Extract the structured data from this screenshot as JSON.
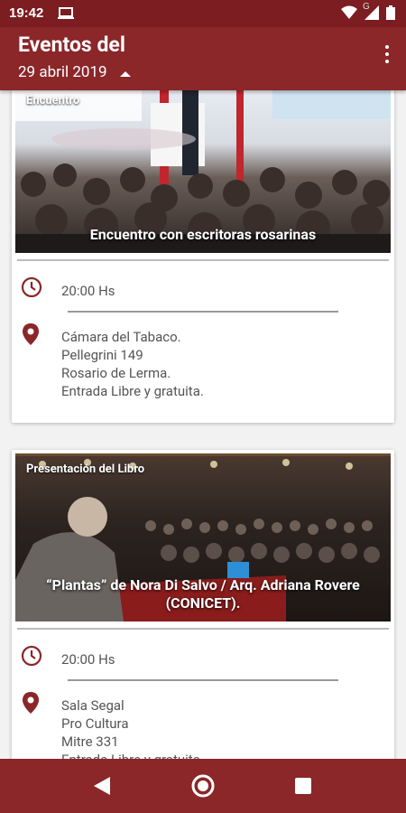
{
  "status": {
    "time": "19:42",
    "signal_label": "G"
  },
  "appbar": {
    "title_line1": "Eventos del",
    "title_line2": "29 abril 2019"
  },
  "events": [
    {
      "category": "Encuentro",
      "caption": "Encuentro con escritoras rosarinas",
      "time": "20:00 Hs",
      "location": [
        "Cámara del Tabaco.",
        "Pellegrini 149",
        "Rosario de Lerma.",
        "Entrada Libre y gratuita."
      ]
    },
    {
      "category": "Presentación del Libro",
      "caption": "“Plantas” de Nora Di Salvo / Arq. Adriana Rovere (CONICET).",
      "time": "20:00 Hs",
      "location": [
        "Sala Segal",
        "Pro Cultura",
        "Mitre 331",
        "Entrada Libre y gratuita."
      ]
    }
  ],
  "colors": {
    "primary": "#8b2629",
    "status_bar": "#7c1d21",
    "accent_icon": "#8b2629"
  },
  "icons": [
    "laptop-icon",
    "wifi-icon",
    "signal-icon",
    "battery-icon",
    "overflow-menu-icon",
    "caret-up-icon",
    "clock-icon",
    "location-pin-icon",
    "back-icon",
    "home-icon",
    "recents-icon"
  ]
}
